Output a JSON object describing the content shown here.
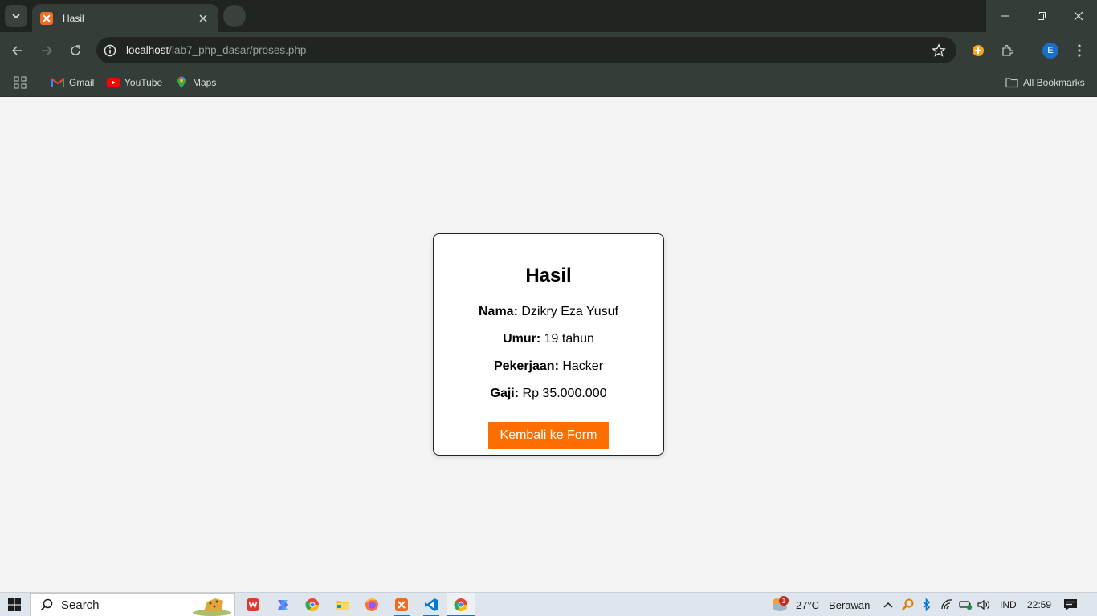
{
  "browser": {
    "tab": {
      "title": "Hasil"
    },
    "url": {
      "host": "localhost",
      "path": "/lab7_php_dasar/proses.php"
    },
    "profile_initial": "E",
    "bookmarks": [
      {
        "label": "Gmail",
        "icon": "gmail-icon"
      },
      {
        "label": "YouTube",
        "icon": "youtube-icon"
      },
      {
        "label": "Maps",
        "icon": "maps-icon"
      }
    ],
    "all_bookmarks_label": "All Bookmarks"
  },
  "page": {
    "title": "Hasil",
    "fields": [
      {
        "label": "Nama:",
        "value": "Dzikry Eza Yusuf"
      },
      {
        "label": "Umur:",
        "value": "19 tahun"
      },
      {
        "label": "Pekerjaan:",
        "value": "Hacker"
      },
      {
        "label": "Gaji:",
        "value": "Rp 35.000.000"
      }
    ],
    "back_button_label": "Kembali ke Form",
    "accent_color": "#ff6e00"
  },
  "taskbar": {
    "search_placeholder": "Search",
    "weather": {
      "temp": "27°C",
      "condition": "Berawan",
      "badge": "1"
    },
    "language": "IND",
    "time": "22:59"
  }
}
